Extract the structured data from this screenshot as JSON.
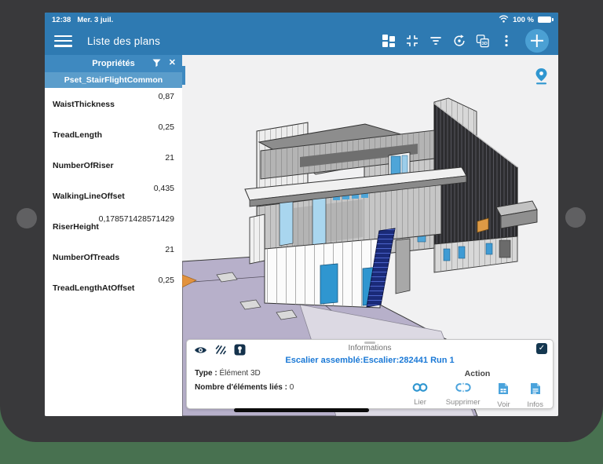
{
  "colors": {
    "toolbar_blue": "#2e7ab2",
    "panel_header_blue": "#3e89c0",
    "pset_header_blue": "#5b9dcb",
    "accent_blue": "#2f96d0",
    "selected_element_navy": "#1a2a78",
    "plaza_purple": "#b7b0ca",
    "background_green": "#487150"
  },
  "status_bar": {
    "time": "12:38",
    "date": "Mer. 3 juil.",
    "battery": "100 %"
  },
  "toolbar": {
    "title": "Liste des plans",
    "icons": [
      "menu-icon",
      "views-grid-icon",
      "fit-screen-icon",
      "filter-icon",
      "rotate-view-icon",
      "views-3d-icon",
      "overflow-menu-icon",
      "add-icon"
    ]
  },
  "properties_panel": {
    "title": "Propriétés",
    "header_icons": [
      "filter-funnel-icon",
      "close-icon"
    ],
    "close_glyph": "✕",
    "pset_title": "Pset_StairFlightCommon",
    "rows": [
      {
        "label": "WaistThickness",
        "value": "0,87"
      },
      {
        "label": "TreadLength",
        "value": "0,25"
      },
      {
        "label": "NumberOfRiser",
        "value": "21"
      },
      {
        "label": "WalkingLineOffset",
        "value": "0,435"
      },
      {
        "label": "RiserHeight",
        "value": "0,178571428571429"
      },
      {
        "label": "NumberOfTreads",
        "value": "21"
      },
      {
        "label": "TreadLengthAtOffset",
        "value": "0,25"
      }
    ]
  },
  "viewport": {
    "icons": [
      "map-pin-icon"
    ]
  },
  "info_panel": {
    "title": "Informations",
    "element_name": "Escalier assemblé:Escalier:282441 Run 1",
    "type_label": "Type :",
    "type_value": "Élément 3D",
    "linked_label": "Nombre d'éléments liés :",
    "linked_value": "0",
    "action_label": "Action",
    "checkbox_glyph": "✓",
    "toolbar_icons": [
      "visibility-eye-icon",
      "hatch-section-icon",
      "isolate-element-icon"
    ],
    "actions": [
      {
        "label": "Lier",
        "icon": "link-icon"
      },
      {
        "label": "Supprimer",
        "icon": "unlink-icon"
      },
      {
        "label": "Voir",
        "icon": "document-view-icon"
      },
      {
        "label": "Infos",
        "icon": "document-info-icon"
      }
    ]
  }
}
